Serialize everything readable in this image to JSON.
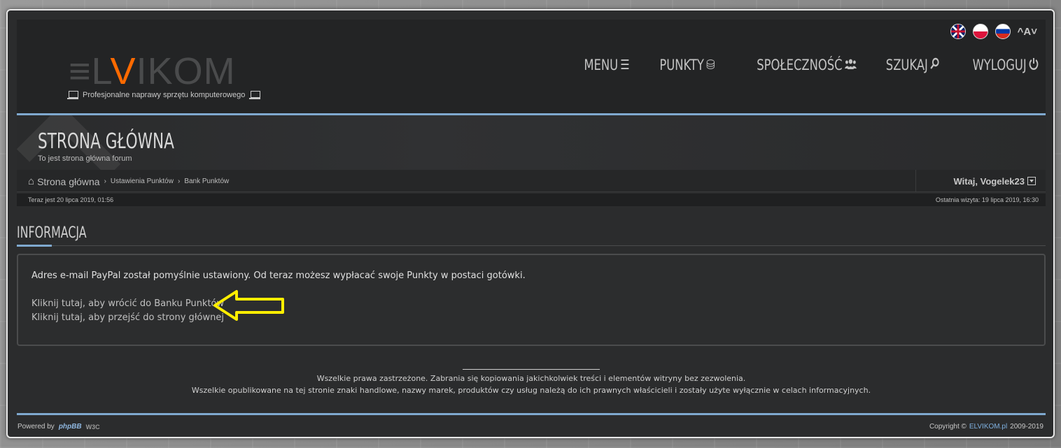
{
  "header": {
    "logo": {
      "part1": "≡L",
      "part2": "V",
      "part3": "IKOM"
    },
    "tagline": "Profesjonalne naprawy sprzętu komputerowego",
    "languages": [
      "english-flag",
      "polish-flag",
      "russian-flag"
    ],
    "font_control": "^A˅",
    "nav": [
      {
        "label": "MENU",
        "icon": "hamburger-icon"
      },
      {
        "label": "PUNKTY",
        "icon": "coins-icon"
      },
      {
        "label": "SPOŁECZNOŚĆ",
        "icon": "users-icon"
      },
      {
        "label": "SZUKAJ",
        "icon": "search-icon"
      },
      {
        "label": "WYLOGUJ",
        "icon": "power-icon"
      }
    ]
  },
  "banner": {
    "title": "STRONA GŁÓWNA",
    "subtitle": "To jest strona główna forum"
  },
  "breadcrumbs": {
    "home": "Strona główna",
    "items": [
      "Ustawienia Punktów",
      "Bank Punktów"
    ],
    "welcome": "Witaj, Vogelek23"
  },
  "timebar": {
    "now": "Teraz jest 20 lipca 2019, 01:56",
    "last_visit": "Ostatnia wizyta: 19 lipca 2019, 16:30"
  },
  "section": {
    "title": "INFORMACJA"
  },
  "panel": {
    "message": "Adres e-mail PayPal został pomyślnie ustawiony. Od teraz możesz wypłacać swoje Punkty w postaci gotówki.",
    "link_bank": "Kliknij tutaj, aby wrócić do Banku Punktów",
    "link_home": "Kliknij tutaj, aby przejść do strony głównej",
    "arrow_color": "#ffee00"
  },
  "footer": {
    "line1": "Wszelkie prawa zastrzeżone. Zabrania się kopiowania jakichkolwiek treści i elementów witryny bez zezwolenia.",
    "line2": "Wszelkie opublikowane na tej stronie znaki handlowe, nazwy marek, produktów czy usług należą do ich prawnych właścicieli i zostały użyte wyłącznie w celach informacyjnych.",
    "powered_by": "Powered by",
    "phpbb": "phpBB",
    "w3c": "W3C",
    "copyright": "Copyright ©",
    "brand": "ELVIKOM.pl",
    "years": "2009-2019"
  },
  "colors": {
    "accent_blue": "#7fa9cf",
    "logo_orange": "#ff6a00",
    "background": "#2b2c2d"
  }
}
